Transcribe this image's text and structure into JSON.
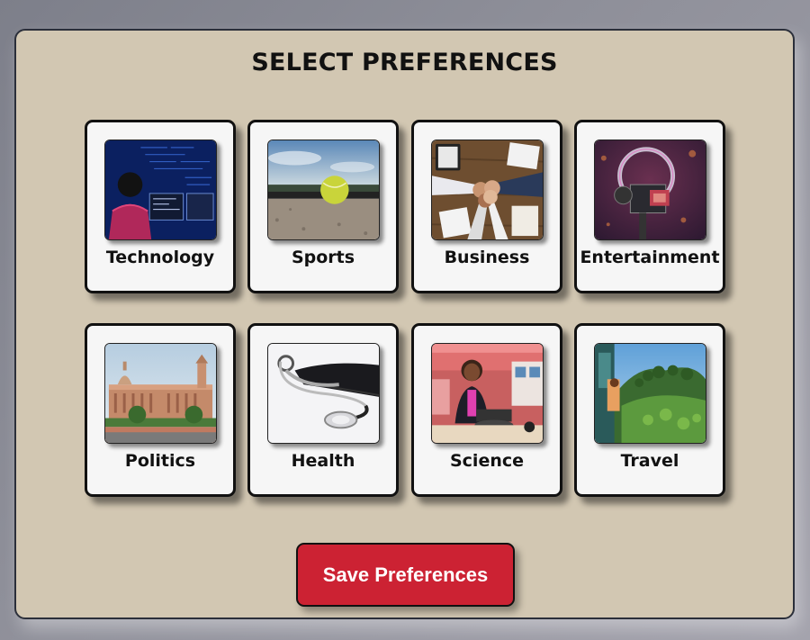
{
  "page": {
    "title": "SELECT PREFERENCES"
  },
  "categories": [
    {
      "label": "Technology",
      "icon": "technology-image"
    },
    {
      "label": "Sports",
      "icon": "sports-image"
    },
    {
      "label": "Business",
      "icon": "business-image"
    },
    {
      "label": "Entertainment",
      "icon": "entertainment-image"
    },
    {
      "label": "Politics",
      "icon": "politics-image"
    },
    {
      "label": "Health",
      "icon": "health-image"
    },
    {
      "label": "Science",
      "icon": "science-image"
    },
    {
      "label": "Travel",
      "icon": "travel-image"
    }
  ],
  "actions": {
    "save_label": "Save Preferences"
  },
  "colors": {
    "panel_bg": "#d2c7b2",
    "card_bg": "#f6f6f6",
    "button_bg": "#cc2233",
    "text": "#111111"
  }
}
